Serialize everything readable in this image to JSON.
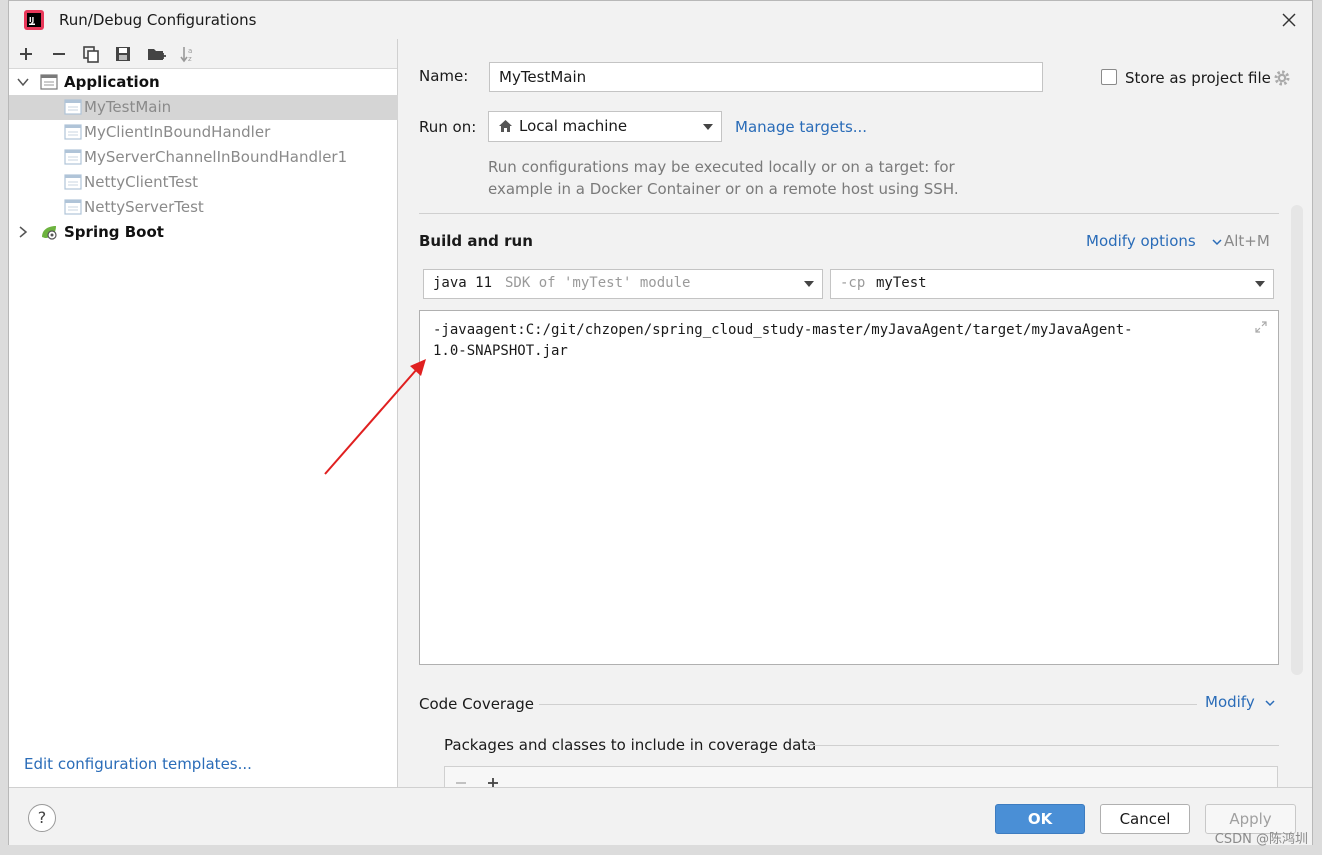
{
  "window": {
    "title": "Run/Debug Configurations"
  },
  "left_panel": {
    "toolbar": [
      "add-icon",
      "remove-icon",
      "copy-icon",
      "save-icon",
      "new-folder-icon",
      "sort-icon"
    ],
    "tree": {
      "groups": [
        {
          "label": "Application",
          "expanded": true,
          "items": [
            {
              "label": "MyTestMain",
              "selected": true
            },
            {
              "label": "MyClientInBoundHandler",
              "selected": false
            },
            {
              "label": "MyServerChannelInBoundHandler1",
              "selected": false
            },
            {
              "label": "NettyClientTest",
              "selected": false
            },
            {
              "label": "NettyServerTest",
              "selected": false
            }
          ]
        },
        {
          "label": "Spring Boot",
          "expanded": false,
          "items": []
        }
      ]
    },
    "edit_templates": "Edit configuration templates..."
  },
  "form": {
    "name_label": "Name:",
    "name_value": "MyTestMain",
    "store_project_label": "Store as project file",
    "store_project_checked": false,
    "run_on_label": "Run on:",
    "run_on_value": "Local machine",
    "manage_targets": "Manage targets...",
    "hint_line1": "Run configurations may be executed locally or on a target: for",
    "hint_line2": "example in a Docker Container or on a remote host using SSH.",
    "build_and_run": "Build and run",
    "modify_options": "Modify options",
    "modify_shortcut": "Alt+M",
    "jdk_main": "java 11",
    "jdk_detail": "SDK of 'myTest' module",
    "cp_prefix": "-cp",
    "cp_value": "myTest",
    "vm_options_line1": "-javaagent:C:/git/chzopen/spring_cloud_study-master/myJavaAgent/target/myJavaAgent-",
    "vm_options_line2": "1.0-SNAPSHOT.jar",
    "code_coverage": "Code Coverage",
    "modify": "Modify",
    "packages_label": "Packages and classes to include in coverage data"
  },
  "buttons": {
    "ok": "OK",
    "cancel": "Cancel",
    "apply": "Apply",
    "help": "?"
  },
  "watermark": "CSDN @陈鸿圳",
  "colors": {
    "accent": "#2a6cb8",
    "ok_button": "#4a8fd6",
    "selection": "#d5d5d5",
    "annotation_arrow": "#e02020"
  }
}
